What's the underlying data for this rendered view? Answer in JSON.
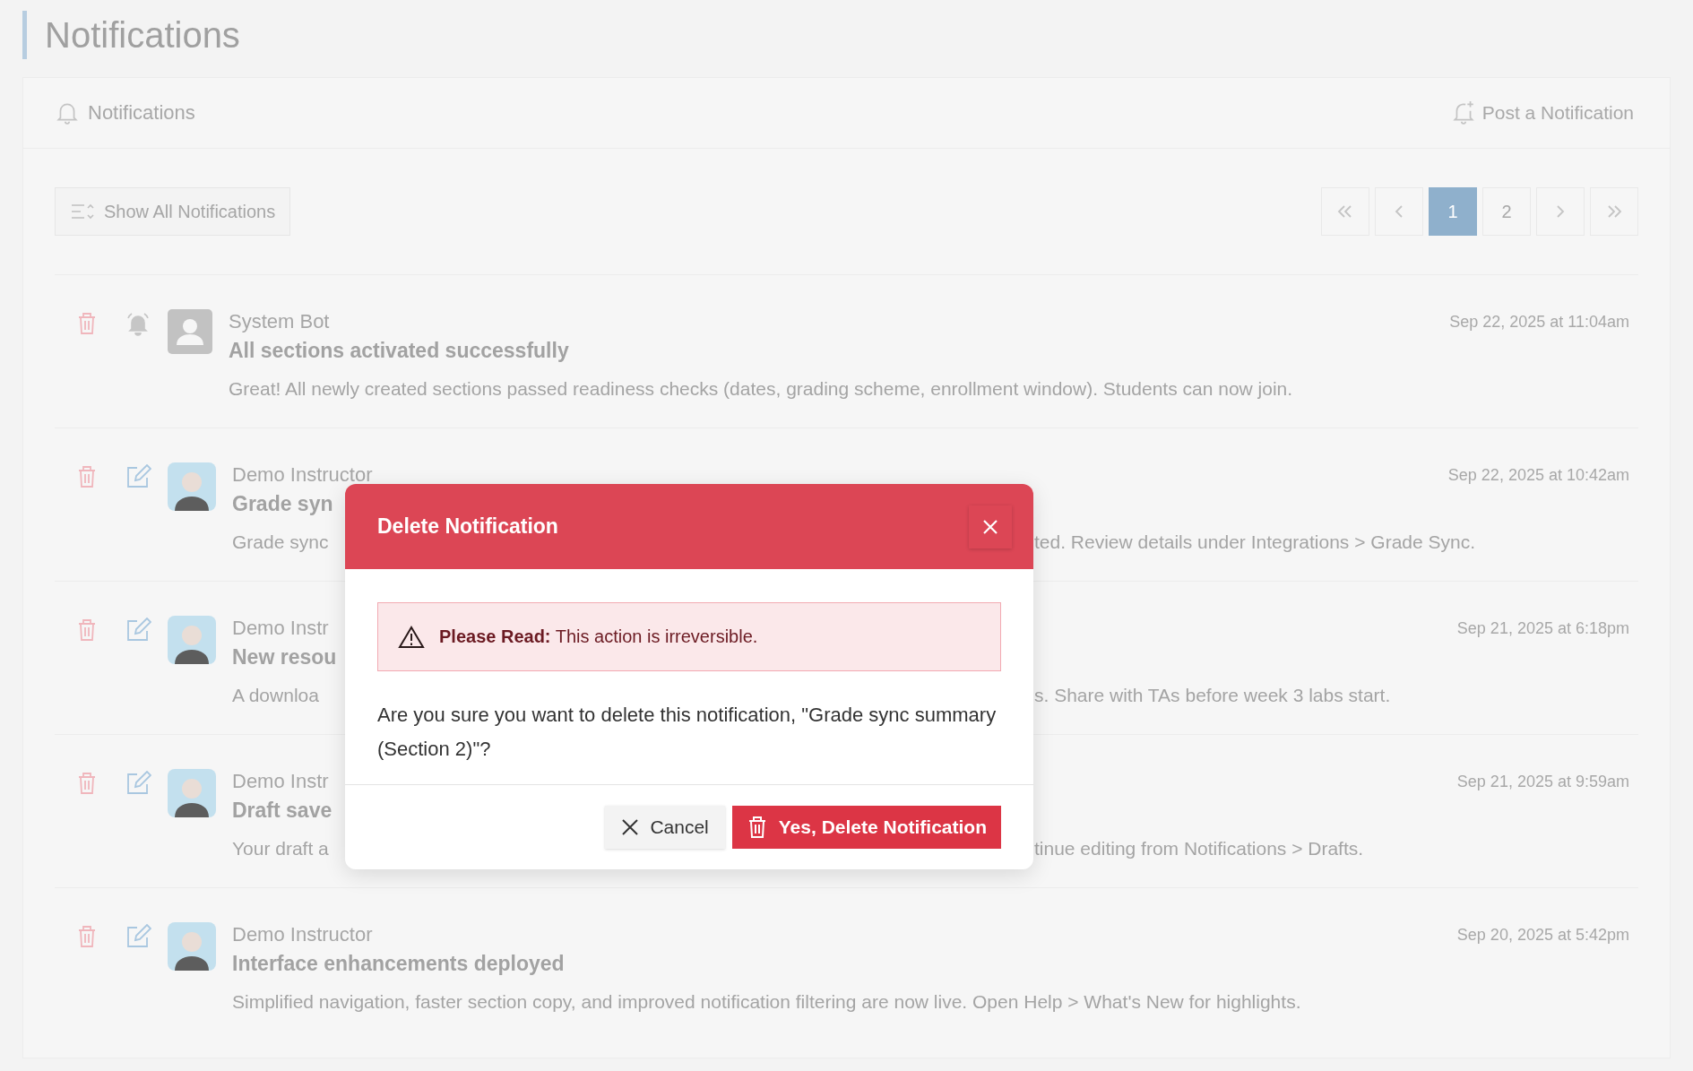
{
  "page_title": "Notifications",
  "card_header": {
    "title": "Notifications",
    "action": "Post a Notification"
  },
  "toolbar": {
    "toggle": "Show All Notifications"
  },
  "pagination": [
    {
      "label": "1",
      "selected": true
    },
    {
      "label": "2",
      "selected": false
    }
  ],
  "notifications": [
    {
      "kind": "system",
      "author": "System Bot",
      "title": "All sections activated successfully",
      "body": "Great! All newly created sections passed readiness checks (dates, grading scheme, enrollment window). Students can now join.",
      "date": "Sep 22, 2025 at 11:04am"
    },
    {
      "kind": "instructor",
      "author": "Demo Instructor",
      "title": "Grade syn",
      "body": "Grade sync",
      "body_after": "ted. Review details under Integrations > Grade Sync.",
      "date": "Sep 22, 2025 at 10:42am"
    },
    {
      "kind": "instructor",
      "author": "Demo Instr",
      "title": "New resou",
      "body": "A downloa",
      "body_after": "s. Share with TAs before week 3 labs start.",
      "date": "Sep 21, 2025 at 6:18pm"
    },
    {
      "kind": "instructor",
      "author": "Demo Instr",
      "title": "Draft save",
      "body": "Your draft a",
      "body_after": "tinue editing from Notifications > Drafts.",
      "date": "Sep 21, 2025 at 9:59am"
    },
    {
      "kind": "instructor",
      "author": "Demo Instructor",
      "title": "Interface enhancements deployed",
      "body": "Simplified navigation, faster section copy, and improved notification filtering are now live. Open Help > What's New for highlights.",
      "date": "Sep 20, 2025 at 5:42pm"
    }
  ],
  "modal": {
    "title": "Delete Notification",
    "alert": "**Please Read:** This action is irreversible.",
    "question": "Are you sure you want to delete this notification, \"Grade sync summary (Section 2)\"?",
    "cancel": "Cancel",
    "confirm": "Yes, Delete Notification"
  }
}
